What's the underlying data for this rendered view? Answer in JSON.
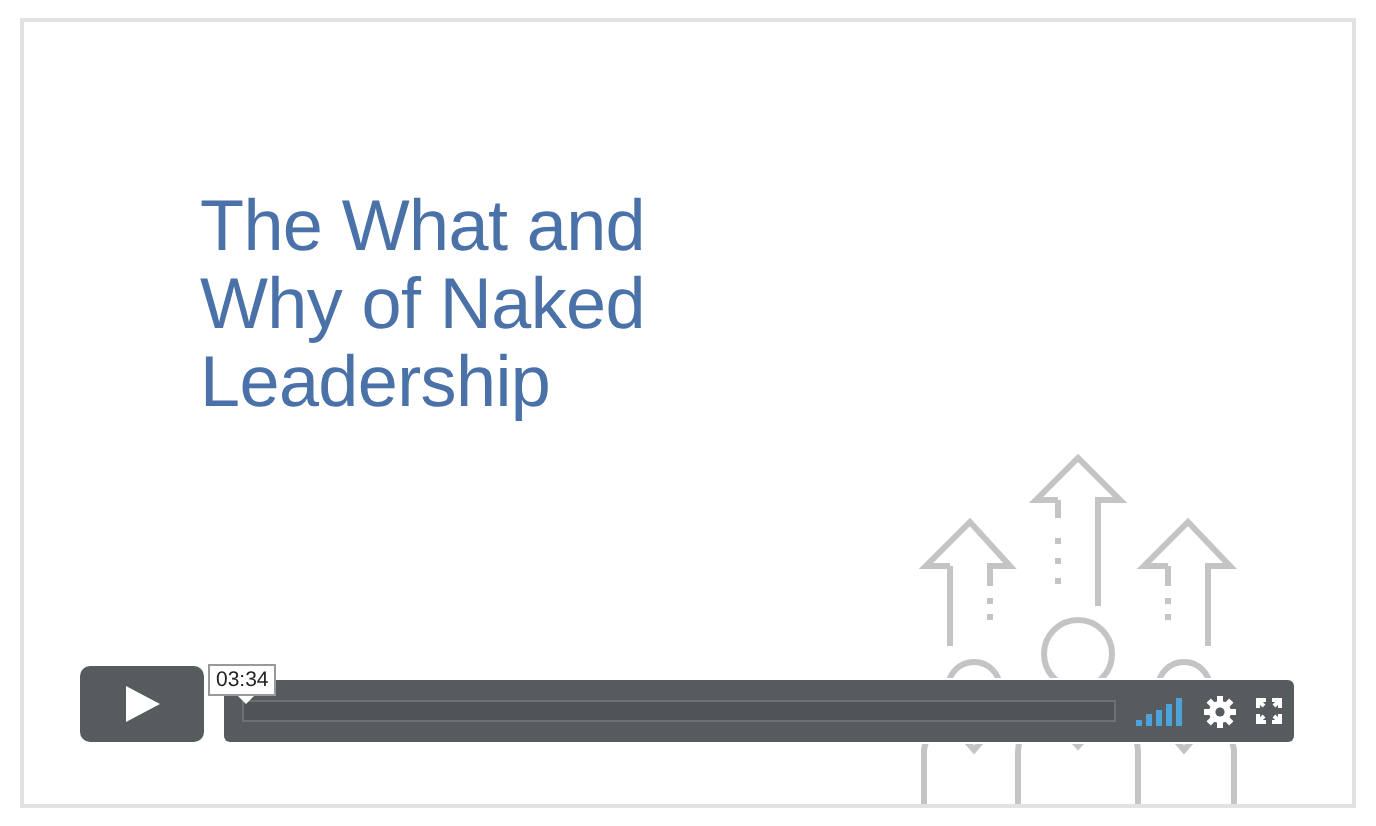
{
  "video": {
    "slide_title_lines": [
      "The What and",
      "Why of Naked",
      "Leadership"
    ],
    "controls": {
      "time_tooltip": "03:34"
    }
  }
}
